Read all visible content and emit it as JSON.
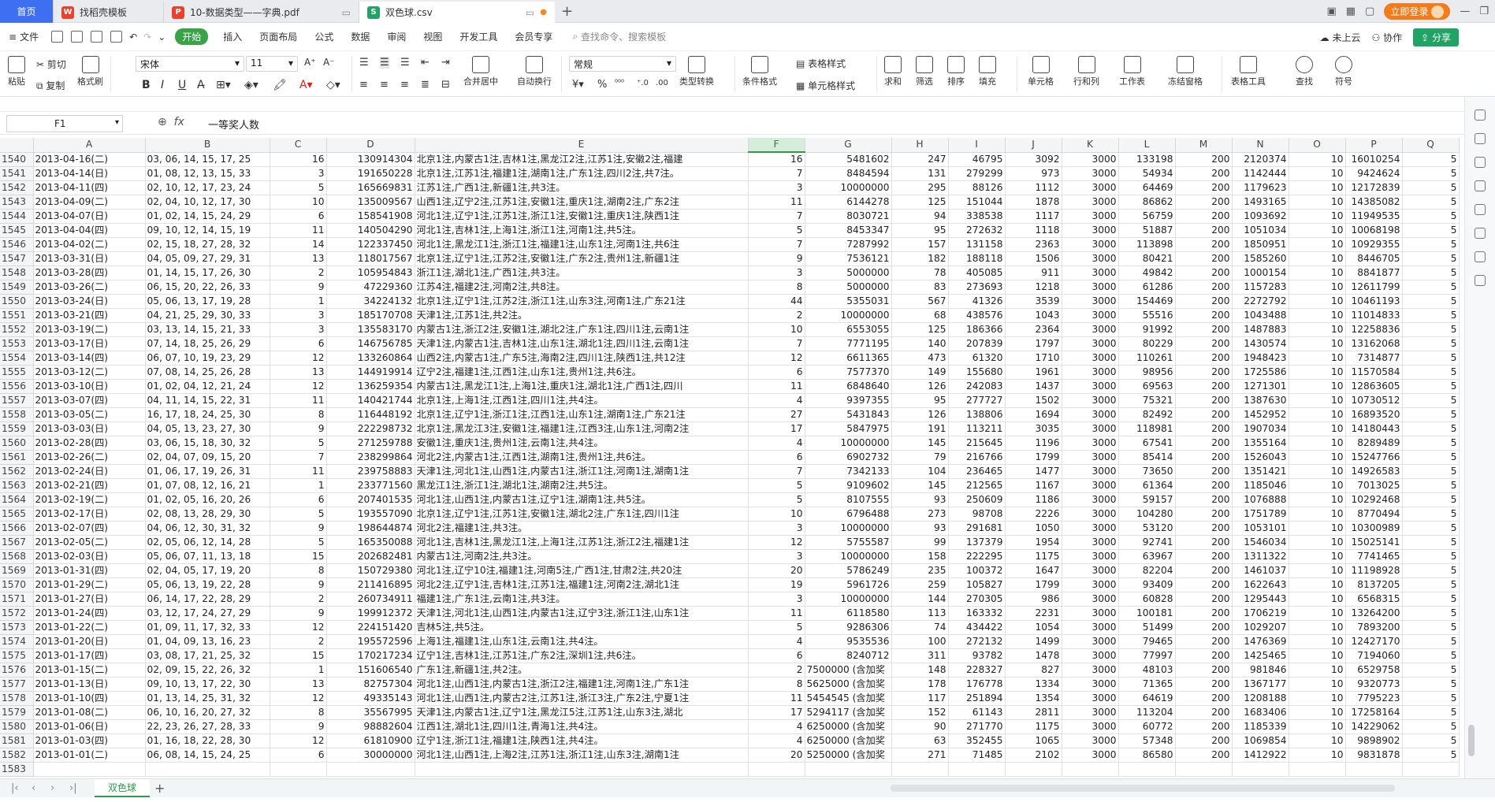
{
  "tabs": [
    {
      "label": "首页"
    },
    {
      "label": "找稻壳模板"
    },
    {
      "label": "10-数据类型——字典.pdf"
    },
    {
      "label": "双色球.csv"
    }
  ],
  "titlebar": {
    "login": "立即登录"
  },
  "menu": {
    "file": "文件",
    "items": [
      "开始",
      "插入",
      "页面布局",
      "公式",
      "数据",
      "审阅",
      "视图",
      "开发工具",
      "会员专享"
    ],
    "search_placeholder": "查找命令、搜索模板",
    "cloud": "未上云",
    "collab": "协作",
    "share": "分享"
  },
  "ribbon": {
    "paste": "粘贴",
    "cut": "剪切",
    "copy": "复制",
    "format_painter": "格式刷",
    "font_name": "宋体",
    "font_size": "11",
    "merge": "合并居中",
    "wrap": "自动换行",
    "num_format": "常规",
    "type_convert": "类型转换",
    "cond_format": "条件格式",
    "table_style": "表格样式",
    "cell_style": "单元格样式",
    "sum": "求和",
    "filter": "筛选",
    "sort": "排序",
    "fill": "填充",
    "cell": "单元格",
    "rowcol": "行和列",
    "worksheet": "工作表",
    "freeze": "冻结窗格",
    "table_tools": "表格工具",
    "find": "查找",
    "symbol": "符号"
  },
  "formula": {
    "cell_ref": "F1",
    "fx": "fx",
    "value": "一等奖人数"
  },
  "sheet": {
    "columns": [
      "A",
      "B",
      "C",
      "D",
      "E",
      "F",
      "G",
      "H",
      "I",
      "J",
      "K",
      "L",
      "M",
      "N",
      "O",
      "P",
      "Q"
    ],
    "rows": [
      [
        "1540",
        "2013-04-16(二)",
        "03, 06, 14, 15, 17, 25",
        "16",
        "130914304",
        "北京1注,内蒙古1注,吉林1注,黑龙江2注,江苏1注,安徽2注,福建",
        "16",
        "5481602",
        "247",
        "46795",
        "3092",
        "3000",
        "133198",
        "200",
        "2120374",
        "10",
        "16010254",
        "5"
      ],
      [
        "1541",
        "2013-04-14(日)",
        "01, 08, 12, 13, 15, 33",
        "3",
        "191650228",
        "北京1注,江苏1注,福建1注,湖南1注,广东1注,四川2注,共7注。",
        "7",
        "8484594",
        "131",
        "279299",
        "973",
        "3000",
        "54934",
        "200",
        "1142444",
        "10",
        "9424624",
        "5"
      ],
      [
        "1542",
        "2013-04-11(四)",
        "02, 10, 12, 17, 23, 24",
        "5",
        "165669831",
        "江苏1注,广西1注,新疆1注,共3注。",
        "3",
        "10000000",
        "295",
        "88126",
        "1112",
        "3000",
        "64469",
        "200",
        "1179623",
        "10",
        "12172839",
        "5"
      ],
      [
        "1543",
        "2013-04-09(二)",
        "02, 04, 10, 12, 17, 30",
        "10",
        "135009567",
        "山西1注,辽宁2注,江苏1注,安徽1注,重庆1注,湖南2注,广东2注",
        "11",
        "6144278",
        "125",
        "151044",
        "1878",
        "3000",
        "86862",
        "200",
        "1493165",
        "10",
        "14385082",
        "5"
      ],
      [
        "1544",
        "2013-04-07(日)",
        "01, 02, 14, 15, 24, 29",
        "6",
        "158541908",
        "河北1注,辽宁1注,江苏1注,浙江1注,安徽1注,重庆1注,陕西1注",
        "7",
        "8030721",
        "94",
        "338538",
        "1117",
        "3000",
        "56759",
        "200",
        "1093692",
        "10",
        "11949535",
        "5"
      ],
      [
        "1545",
        "2013-04-04(四)",
        "09, 10, 12, 14, 15, 19",
        "11",
        "140504290",
        "河北1注,吉林1注,上海1注,浙江1注,河南1注,共5注。",
        "5",
        "8453347",
        "95",
        "272632",
        "1118",
        "3000",
        "51887",
        "200",
        "1051034",
        "10",
        "10068198",
        "5"
      ],
      [
        "1546",
        "2013-04-02(二)",
        "02, 15, 18, 27, 28, 32",
        "14",
        "122337450",
        "河北1注,黑龙江1注,浙江1注,福建1注,山东1注,河南1注,共6注",
        "7",
        "7287992",
        "157",
        "131158",
        "2363",
        "3000",
        "113898",
        "200",
        "1850951",
        "10",
        "10929355",
        "5"
      ],
      [
        "1547",
        "2013-03-31(日)",
        "04, 05, 09, 27, 29, 31",
        "13",
        "118017567",
        "北京1注,辽宁1注,江苏2注,安徽1注,广东2注,贵州1注,新疆1注",
        "9",
        "7536121",
        "182",
        "188118",
        "1506",
        "3000",
        "80421",
        "200",
        "1585260",
        "10",
        "8446705",
        "5"
      ],
      [
        "1548",
        "2013-03-28(四)",
        "01, 14, 15, 17, 26, 30",
        "2",
        "105954843",
        "浙江1注,湖北1注,广西1注,共3注。",
        "3",
        "5000000",
        "78",
        "405085",
        "911",
        "3000",
        "49842",
        "200",
        "1000154",
        "10",
        "8841877",
        "5"
      ],
      [
        "1549",
        "2013-03-26(二)",
        "06, 15, 20, 22, 26, 33",
        "9",
        "47229360",
        "江苏4注,福建2注,河南2注,共8注。",
        "8",
        "5000000",
        "83",
        "273693",
        "1218",
        "3000",
        "61286",
        "200",
        "1157283",
        "10",
        "12611799",
        "5"
      ],
      [
        "1550",
        "2013-03-24(日)",
        "05, 06, 13, 17, 19, 28",
        "1",
        "34224132",
        "北京1注,辽宁1注,江苏2注,浙江1注,山东3注,河南1注,广东21注",
        "44",
        "5355031",
        "567",
        "41326",
        "3539",
        "3000",
        "154469",
        "200",
        "2272792",
        "10",
        "10461193",
        "5"
      ],
      [
        "1551",
        "2013-03-21(四)",
        "04, 21, 25, 29, 30, 33",
        "3",
        "185170708",
        "天津1注,江苏1注,共2注。",
        "2",
        "10000000",
        "68",
        "438576",
        "1043",
        "3000",
        "55516",
        "200",
        "1043488",
        "10",
        "11014833",
        "5"
      ],
      [
        "1552",
        "2013-03-19(二)",
        "03, 13, 14, 15, 21, 33",
        "3",
        "135583170",
        "内蒙古1注,浙江2注,安徽1注,湖北2注,广东1注,四川1注,云南1注",
        "10",
        "6553055",
        "125",
        "186366",
        "2364",
        "3000",
        "91992",
        "200",
        "1487883",
        "10",
        "12258836",
        "5"
      ],
      [
        "1553",
        "2013-03-17(日)",
        "07, 14, 18, 25, 26, 29",
        "6",
        "146756785",
        "天津1注,内蒙古1注,吉林1注,山东1注,湖北1注,四川1注,云南1注",
        "7",
        "7771195",
        "140",
        "207839",
        "1797",
        "3000",
        "80229",
        "200",
        "1430574",
        "10",
        "13162068",
        "5"
      ],
      [
        "1554",
        "2013-03-14(四)",
        "06, 07, 10, 19, 23, 29",
        "12",
        "133260864",
        "山西2注,内蒙古1注,广东5注,海南2注,四川1注,陕西1注,共12注",
        "12",
        "6611365",
        "473",
        "61320",
        "1710",
        "3000",
        "110261",
        "200",
        "1948423",
        "10",
        "7314877",
        "5"
      ],
      [
        "1555",
        "2013-03-12(二)",
        "07, 08, 14, 25, 26, 28",
        "13",
        "144919914",
        "辽宁2注,福建1注,江西1注,山东1注,贵州1注,共6注。",
        "6",
        "7577370",
        "149",
        "155680",
        "1961",
        "3000",
        "98956",
        "200",
        "1725586",
        "10",
        "11570584",
        "5"
      ],
      [
        "1556",
        "2013-03-10(日)",
        "01, 02, 04, 12, 21, 24",
        "12",
        "136259354",
        "内蒙古1注,黑龙江1注,上海1注,重庆1注,湖北1注,广西1注,四川",
        "11",
        "6848640",
        "126",
        "242083",
        "1437",
        "3000",
        "69563",
        "200",
        "1271301",
        "10",
        "12863605",
        "5"
      ],
      [
        "1557",
        "2013-03-07(四)",
        "04, 11, 14, 15, 22, 31",
        "11",
        "140421744",
        "北京1注,上海1注,江西1注,四川1注,共4注。",
        "4",
        "9397355",
        "95",
        "277727",
        "1502",
        "3000",
        "75321",
        "200",
        "1387630",
        "10",
        "10730512",
        "5"
      ],
      [
        "1558",
        "2013-03-05(二)",
        "16, 17, 18, 24, 25, 30",
        "8",
        "116448192",
        "北京1注,辽宁1注,浙江1注,江西1注,山东1注,湖南1注,广东21注",
        "27",
        "5431843",
        "126",
        "138806",
        "1694",
        "3000",
        "82492",
        "200",
        "1452952",
        "10",
        "16893520",
        "5"
      ],
      [
        "1559",
        "2013-03-03(日)",
        "04, 05, 13, 23, 27, 30",
        "9",
        "222298732",
        "北京1注,黑龙江3注,安徽1注,福建1注,江西3注,山东1注,河南2注",
        "17",
        "5847975",
        "191",
        "113211",
        "3035",
        "3000",
        "118981",
        "200",
        "1907034",
        "10",
        "14180443",
        "5"
      ],
      [
        "1560",
        "2013-02-28(四)",
        "03, 06, 15, 18, 30, 32",
        "5",
        "271259788",
        "安徽1注,重庆1注,贵州1注,云南1注,共4注。",
        "4",
        "10000000",
        "145",
        "215645",
        "1196",
        "3000",
        "67541",
        "200",
        "1355164",
        "10",
        "8289489",
        "5"
      ],
      [
        "1561",
        "2013-02-26(二)",
        "02, 04, 07, 09, 15, 20",
        "7",
        "238299864",
        "河北2注,内蒙古1注,江西1注,湖南1注,贵州1注,共6注。",
        "6",
        "6902732",
        "79",
        "216766",
        "1799",
        "3000",
        "85414",
        "200",
        "1526043",
        "10",
        "15247766",
        "5"
      ],
      [
        "1562",
        "2013-02-24(日)",
        "01, 06, 17, 19, 26, 31",
        "11",
        "239758883",
        "天津1注,河北1注,山西1注,内蒙古1注,浙江1注,河南1注,湖南1注",
        "7",
        "7342133",
        "104",
        "236465",
        "1477",
        "3000",
        "73650",
        "200",
        "1351421",
        "10",
        "14926583",
        "5"
      ],
      [
        "1563",
        "2013-02-21(四)",
        "01, 07, 08, 12, 16, 21",
        "1",
        "233771560",
        "黑龙江1注,浙江1注,湖北1注,湖南2注,共5注。",
        "5",
        "9109602",
        "145",
        "212565",
        "1167",
        "3000",
        "61364",
        "200",
        "1185046",
        "10",
        "7013025",
        "5"
      ],
      [
        "1564",
        "2013-02-19(二)",
        "01, 02, 05, 16, 20, 26",
        "6",
        "207401535",
        "河北1注,山西1注,内蒙古1注,辽宁1注,湖南1注,共5注。",
        "5",
        "8107555",
        "93",
        "250609",
        "1186",
        "3000",
        "59157",
        "200",
        "1076888",
        "10",
        "10292468",
        "5"
      ],
      [
        "1565",
        "2013-02-17(日)",
        "02, 08, 13, 28, 29, 30",
        "5",
        "193557090",
        "北京1注,辽宁1注,江苏1注,安徽1注,湖北2注,广东1注,四川1注",
        "10",
        "6796488",
        "273",
        "98708",
        "2226",
        "3000",
        "104280",
        "200",
        "1751789",
        "10",
        "8770494",
        "5"
      ],
      [
        "1566",
        "2013-02-07(四)",
        "04, 06, 12, 30, 31, 32",
        "9",
        "198644874",
        "河北2注,福建1注,共3注。",
        "3",
        "10000000",
        "93",
        "291681",
        "1050",
        "3000",
        "53120",
        "200",
        "1053101",
        "10",
        "10300989",
        "5"
      ],
      [
        "1567",
        "2013-02-05(二)",
        "02, 05, 06, 12, 14, 28",
        "5",
        "165350088",
        "河北1注,吉林1注,黑龙江1注,上海1注,江苏1注,浙江2注,福建1注",
        "12",
        "5755587",
        "99",
        "137379",
        "1954",
        "3000",
        "92741",
        "200",
        "1546034",
        "10",
        "15025141",
        "5"
      ],
      [
        "1568",
        "2013-02-03(日)",
        "05, 06, 07, 11, 13, 18",
        "15",
        "202682481",
        "内蒙古1注,河南2注,共3注。",
        "3",
        "10000000",
        "158",
        "222295",
        "1175",
        "3000",
        "63967",
        "200",
        "1311322",
        "10",
        "7741465",
        "5"
      ],
      [
        "1569",
        "2013-01-31(四)",
        "02, 04, 05, 17, 19, 20",
        "8",
        "150729380",
        "河北1注,辽宁10注,福建1注,河南5注,广西1注,甘肃2注,共20注",
        "20",
        "5786249",
        "235",
        "100372",
        "1647",
        "3000",
        "82204",
        "200",
        "1461037",
        "10",
        "11198928",
        "5"
      ],
      [
        "1570",
        "2013-01-29(二)",
        "05, 06, 13, 19, 22, 28",
        "9",
        "211416895",
        "河北2注,辽宁1注,吉林1注,江苏1注,福建1注,河南2注,湖北1注",
        "19",
        "5961726",
        "259",
        "105827",
        "1799",
        "3000",
        "93409",
        "200",
        "1622643",
        "10",
        "8137205",
        "5"
      ],
      [
        "1571",
        "2013-01-27(日)",
        "06, 14, 17, 22, 28, 29",
        "2",
        "260734911",
        "福建1注,广东1注,云南1注,共3注。",
        "3",
        "10000000",
        "144",
        "270305",
        "986",
        "3000",
        "60828",
        "200",
        "1295443",
        "10",
        "6568315",
        "5"
      ],
      [
        "1572",
        "2013-01-24(四)",
        "03, 12, 17, 24, 27, 29",
        "9",
        "199912372",
        "天津1注,河北1注,山西1注,内蒙古1注,辽宁3注,浙江1注,山东1注",
        "11",
        "6118580",
        "113",
        "163332",
        "2231",
        "3000",
        "100181",
        "200",
        "1706219",
        "10",
        "13264200",
        "5"
      ],
      [
        "1573",
        "2013-01-22(二)",
        "01, 09, 11, 17, 32, 33",
        "12",
        "224151420",
        "吉林5注,共5注。",
        "5",
        "9286306",
        "74",
        "434422",
        "1054",
        "3000",
        "51499",
        "200",
        "1029207",
        "10",
        "7893200",
        "5"
      ],
      [
        "1574",
        "2013-01-20(日)",
        "01, 04, 09, 13, 16, 23",
        "2",
        "195572596",
        "上海1注,福建1注,山东1注,云南1注,共4注。",
        "4",
        "9535536",
        "100",
        "272132",
        "1499",
        "3000",
        "79465",
        "200",
        "1476369",
        "10",
        "12427170",
        "5"
      ],
      [
        "1575",
        "2013-01-17(四)",
        "03, 08, 17, 21, 25, 32",
        "15",
        "170217234",
        "辽宁1注,吉林1注,江苏1注,广东2注,深圳1注,共6注。",
        "6",
        "8240712",
        "311",
        "93782",
        "1478",
        "3000",
        "77997",
        "200",
        "1425465",
        "10",
        "7194060",
        "5"
      ],
      [
        "1576",
        "2013-01-15(二)",
        "02, 09, 15, 22, 26, 32",
        "1",
        "151606540",
        "广东1注,新疆1注,共2注。",
        "2",
        "7500000 (含加奖",
        "148",
        "228327",
        "827",
        "3000",
        "48103",
        "200",
        "981846",
        "10",
        "6529758",
        "5"
      ],
      [
        "1577",
        "2013-01-13(日)",
        "09, 10, 13, 17, 22, 30",
        "13",
        "82757304",
        "河北1注,山西1注,内蒙古1注,浙江2注,福建1注,河南1注,广东1注",
        "8",
        "5625000 (含加奖",
        "178",
        "176778",
        "1334",
        "3000",
        "71365",
        "200",
        "1367177",
        "10",
        "9320773",
        "5"
      ],
      [
        "1578",
        "2013-01-10(四)",
        "01, 13, 14, 25, 31, 32",
        "12",
        "49335143",
        "河北1注,山西1注,内蒙古2注,江苏1注,浙江3注,广东2注,宁夏1注",
        "11",
        "5454545 (含加奖",
        "117",
        "251894",
        "1354",
        "3000",
        "64619",
        "200",
        "1208188",
        "10",
        "7795223",
        "5"
      ],
      [
        "1579",
        "2013-01-08(二)",
        "06, 10, 16, 20, 27, 32",
        "8",
        "35567995",
        "天津1注,内蒙古1注,辽宁1注,黑龙江5注,江苏1注,山东3注,湖北",
        "17",
        "5294117 (含加奖",
        "152",
        "61143",
        "2811",
        "3000",
        "113204",
        "200",
        "1683406",
        "10",
        "17258164",
        "5"
      ],
      [
        "1580",
        "2013-01-06(日)",
        "22, 23, 26, 27, 28, 33",
        "9",
        "98882604",
        "江西1注,湖北1注,四川1注,青海1注,共4注。",
        "4",
        "6250000 (含加奖",
        "90",
        "271770",
        "1175",
        "3000",
        "60772",
        "200",
        "1185339",
        "10",
        "14229062",
        "5"
      ],
      [
        "1581",
        "2013-01-03(四)",
        "01, 16, 18, 22, 28, 30",
        "12",
        "61810900",
        "辽宁1注,浙江1注,福建1注,陕西1注,共4注。",
        "4",
        "6250000 (含加奖",
        "63",
        "352455",
        "1065",
        "3000",
        "57348",
        "200",
        "1069854",
        "10",
        "9898902",
        "5"
      ],
      [
        "1582",
        "2013-01-01(二)",
        "06, 08, 14, 15, 24, 25",
        "6",
        "30000000",
        "河北1注,山西1注,上海2注,江苏1注,浙江1注,山东3注,湖南1注",
        "20",
        "5250000 (含加奖",
        "271",
        "71485",
        "2102",
        "3000",
        "86580",
        "200",
        "1412922",
        "10",
        "9831878",
        "5"
      ],
      [
        "1583",
        "",
        "",
        "",
        "",
        "",
        "",
        "",
        "",
        "",
        "",
        "",
        "",
        "",
        "",
        "",
        "",
        ""
      ]
    ]
  },
  "sheet_tab": "双色球"
}
